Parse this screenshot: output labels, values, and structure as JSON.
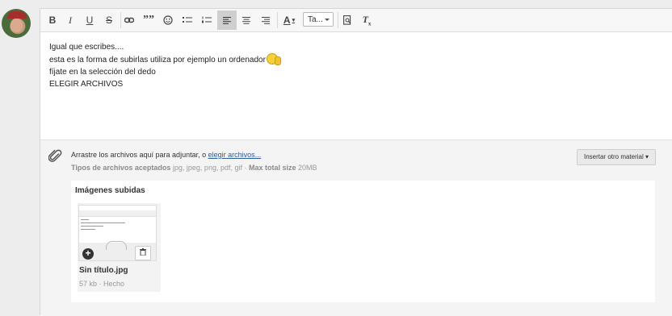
{
  "toolbar": {
    "bold": "B",
    "italic": "I",
    "underline": "U",
    "strike": "S",
    "quote": "””",
    "font_select": "Ta...",
    "text_color_label": "A",
    "clear_format": "T"
  },
  "editor": {
    "lines": [
      "Igual que escribes....",
      "esta es la forma de subirlas utiliza por ejemplo un ordenador",
      "fíjate en la selección del dedo",
      "ELEGIR ARCHIVOS"
    ]
  },
  "attachments": {
    "drop_text_prefix": "Arrastre los archivos aquí para adjuntar, o ",
    "choose_link": "elegir archivos...",
    "types_label": "Tipos de archivos aceptados",
    "types_value": "jpg, jpeg, png, pdf, gif",
    "max_label": "Max total size",
    "max_value": "20MB",
    "separator": "·",
    "insert_button": "Insertar otro material ▾",
    "uploaded_title": "Imágenes subidas",
    "file": {
      "name": "Sin título.jpg",
      "meta": "57 kb · Hecho"
    }
  }
}
